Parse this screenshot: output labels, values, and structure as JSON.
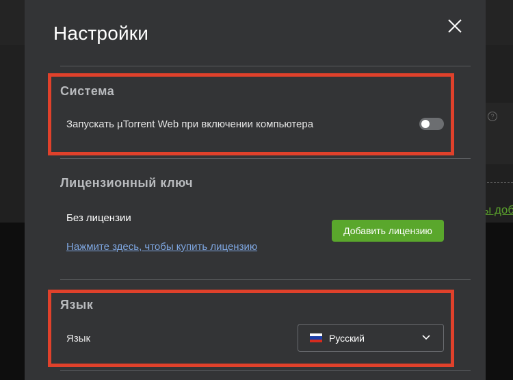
{
  "background": {
    "help_glyph": "?",
    "partial_link_text": "ы доб"
  },
  "modal": {
    "title": "Настройки",
    "close_icon": "close-icon"
  },
  "system": {
    "title": "Система",
    "startup_label": "Запускать µTorrent Web при включении компьютера",
    "startup_enabled": false
  },
  "license": {
    "title": "Лицензионный ключ",
    "status": "Без лицензии",
    "buy_link": "Нажмите здесь, чтобы купить лицензию",
    "add_button": "Добавить лицензию"
  },
  "language": {
    "title": "Язык",
    "label": "Язык",
    "selected": "Русский",
    "flag_icon": "russia-flag-icon"
  },
  "colors": {
    "accent_green": "#5aa72c",
    "highlight_red": "#e0412b",
    "link_blue": "#7ea6e0",
    "modal_bg": "#333436"
  }
}
